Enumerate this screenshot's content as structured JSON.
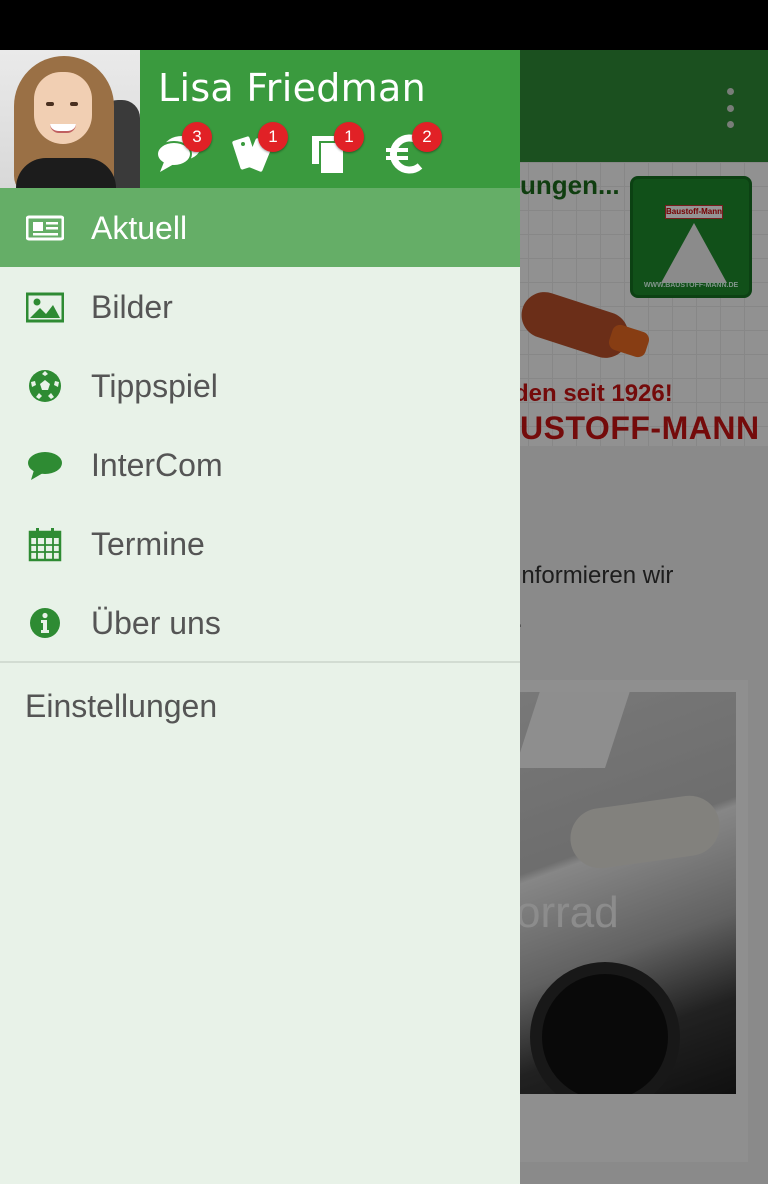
{
  "colors": {
    "brand_green": "#3a9a3e",
    "active_green": "#65ae67",
    "icon_green": "#2e8b33",
    "badge_red": "#e12126",
    "drawer_bg": "#e8f2e8"
  },
  "background": {
    "banner": {
      "top_text": "ungen...",
      "logo_sign": "Baustoff-Mann",
      "logo_web": "WWW.BAUSTOFF-MANN.DE",
      "slogan": "den seit 1926!",
      "brand": "USTOFF-MANN"
    },
    "body_line_1": "informieren wir",
    "body_line_2": ".",
    "photo_title": "orrad"
  },
  "drawer": {
    "user": {
      "name": "Lisa Friedman"
    },
    "header_icons": [
      {
        "icon": "chat-bubbles-icon",
        "badge": "3"
      },
      {
        "icon": "tickets-icon",
        "badge": "1"
      },
      {
        "icon": "documents-icon",
        "badge": "1"
      },
      {
        "icon": "euro-icon",
        "badge": "2"
      }
    ],
    "items": [
      {
        "label": "Aktuell",
        "icon": "newspaper-icon",
        "active": true
      },
      {
        "label": "Bilder",
        "icon": "image-icon",
        "active": false
      },
      {
        "label": "Tippspiel",
        "icon": "soccer-ball-icon",
        "active": false
      },
      {
        "label": "InterCom",
        "icon": "speech-bubble-icon",
        "active": false
      },
      {
        "label": "Termine",
        "icon": "calendar-icon",
        "active": false
      },
      {
        "label": "Über uns",
        "icon": "info-icon",
        "active": false
      }
    ],
    "settings_label": "Einstellungen"
  }
}
